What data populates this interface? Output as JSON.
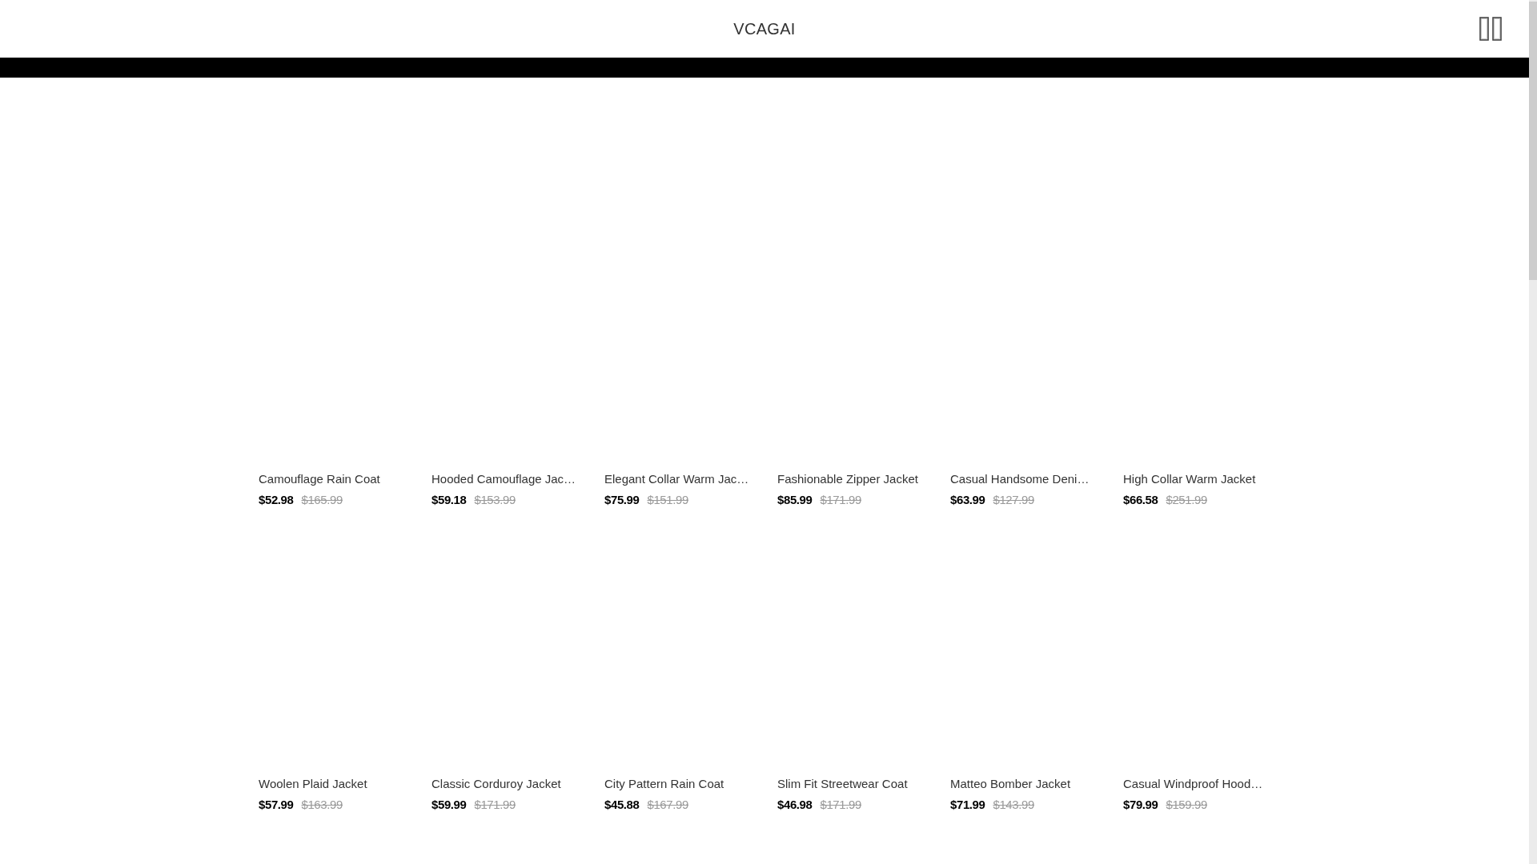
{
  "header": {
    "logo": "VCAGAI"
  },
  "products": [
    {
      "name": "Camouflage Rain Coat",
      "price": "$52.98",
      "original_price": "$165.99"
    },
    {
      "name": "Hooded Camouflage Jac…",
      "price": "$59.18",
      "original_price": "$153.99"
    },
    {
      "name": "Elegant Collar Warm Jac…",
      "price": "$75.99",
      "original_price": "$151.99"
    },
    {
      "name": "Fashionable Zipper Jacket",
      "price": "$85.99",
      "original_price": "$171.99"
    },
    {
      "name": "Casual Handsome Deni…",
      "price": "$63.99",
      "original_price": "$127.99"
    },
    {
      "name": "High Collar Warm Jacket",
      "price": "$66.58",
      "original_price": "$251.99"
    },
    {
      "name": "Woolen Plaid Jacket",
      "price": "$57.99",
      "original_price": "$163.99"
    },
    {
      "name": "Classic Corduroy Jacket",
      "price": "$59.99",
      "original_price": "$171.99"
    },
    {
      "name": "City Pattern Rain Coat",
      "price": "$45.88",
      "original_price": "$167.99"
    },
    {
      "name": "Slim Fit Streetwear Coat",
      "price": "$46.98",
      "original_price": "$171.99"
    },
    {
      "name": "Matteo Bomber Jacket",
      "price": "$71.99",
      "original_price": "$143.99"
    },
    {
      "name": "Casual Windproof Hood…",
      "price": "$79.99",
      "original_price": "$159.99"
    }
  ]
}
